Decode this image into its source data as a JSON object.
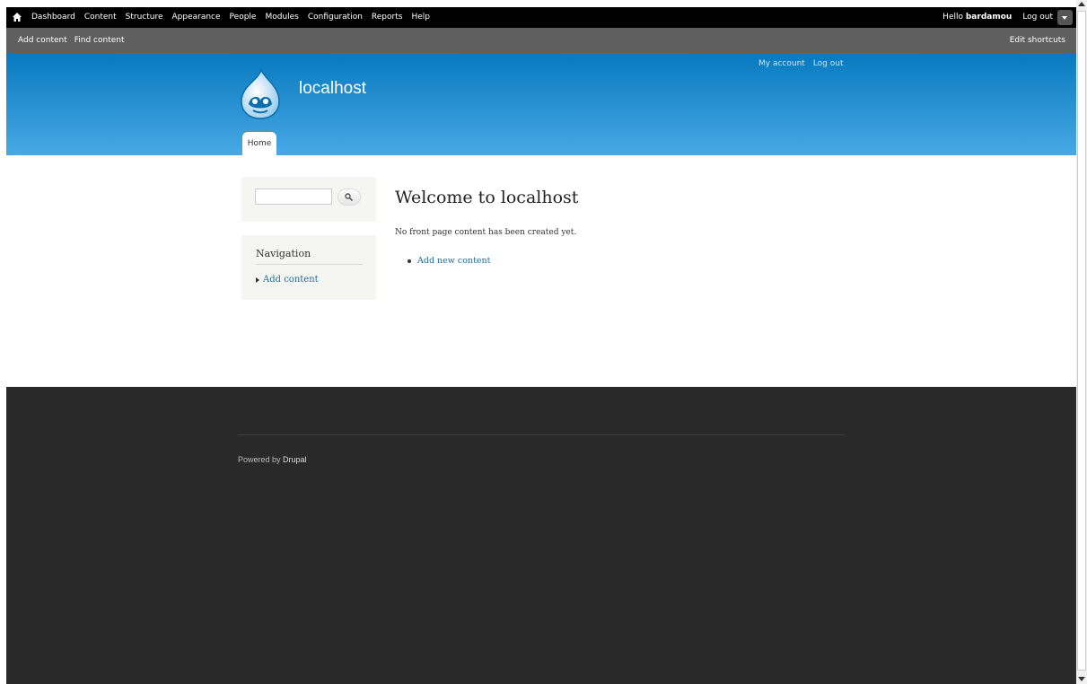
{
  "toolbar": {
    "menu": [
      "Dashboard",
      "Content",
      "Structure",
      "Appearance",
      "People",
      "Modules",
      "Configuration",
      "Reports",
      "Help"
    ],
    "hello": "Hello",
    "username": "bardamou",
    "logout": "Log out"
  },
  "shortcuts": {
    "items": [
      "Add content",
      "Find content"
    ],
    "edit": "Edit shortcuts"
  },
  "header": {
    "site_name": "localhost",
    "secondary_menu": [
      "My account",
      "Log out"
    ],
    "tabs": [
      "Home"
    ]
  },
  "sidebar": {
    "search_value": "",
    "navigation": {
      "title": "Navigation",
      "items": [
        "Add content"
      ]
    }
  },
  "main": {
    "title": "Welcome to localhost",
    "intro": "No front page content has been created yet.",
    "links": [
      "Add new content"
    ]
  },
  "footer": {
    "powered_by": "Powered by",
    "drupal": "Drupal"
  },
  "colors": {
    "header_top": "#0779bf",
    "header_bottom": "#48a9e4",
    "footer_bg": "#292929",
    "link": "#1a6e9b",
    "toolbar_bg": "#000000",
    "shortcut_bar_bg": "#5f5f5f"
  },
  "icons": {
    "home": "home-icon",
    "logo": "drupal-logo-icon",
    "search": "magnifier-icon",
    "toggle": "chevron-down-icon"
  }
}
